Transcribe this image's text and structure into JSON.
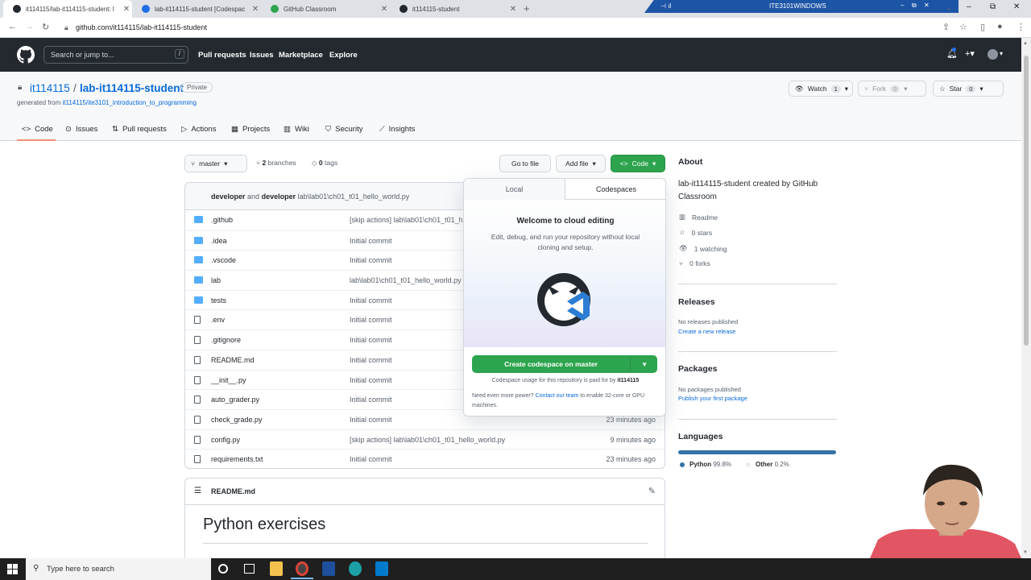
{
  "browser": {
    "tabs": [
      {
        "title": "it114115/lab-it114115-student: l",
        "active": true
      },
      {
        "title": "lab-it114115-student [Codespac",
        "active": false
      },
      {
        "title": "GitHub Classroom",
        "active": false
      },
      {
        "title": "it114115-student",
        "active": false
      }
    ],
    "remote_title": "ITE3101WINDOWS",
    "url": "github.com/it114115/lab-it114115-student"
  },
  "gh_header": {
    "search_placeholder": "Search or jump to...",
    "search_key": "/",
    "nav": [
      "Pull requests",
      "Issues",
      "Marketplace",
      "Explore"
    ]
  },
  "repo": {
    "owner": "it114115",
    "sep": "/",
    "name": "lab-it114115-student",
    "visibility": "Private",
    "generated_prefix": "generated from",
    "generated_link": "it114115/ite3101_introduction_to_programming",
    "watch_label": "Watch",
    "watch_count": "1",
    "fork_label": "Fork",
    "fork_count": "0",
    "star_label": "Star",
    "star_count": "0",
    "tabs": [
      "Code",
      "Issues",
      "Pull requests",
      "Actions",
      "Projects",
      "Wiki",
      "Security",
      "Insights"
    ]
  },
  "toolbar": {
    "branch": "master",
    "branches": "2",
    "branches_label": "branches",
    "tags": "0",
    "tags_label": "tags",
    "go_to_file": "Go to file",
    "add_file": "Add file",
    "code": "Code"
  },
  "commit": {
    "author1": "developer",
    "and": "and",
    "author2": "developer",
    "message": "lab\\lab01\\ch01_t01_hello_world.py"
  },
  "files": [
    {
      "name": ".github",
      "type": "dir",
      "msg": "[skip actions] lab\\lab01\\ch01_t01_h",
      "time": ""
    },
    {
      "name": ".idea",
      "type": "dir",
      "msg": "Initial commit",
      "time": ""
    },
    {
      "name": ".vscode",
      "type": "dir",
      "msg": "Initial commit",
      "time": ""
    },
    {
      "name": "lab",
      "type": "dir",
      "msg": "lab\\lab01\\ch01_t01_hello_world.py",
      "time": ""
    },
    {
      "name": "tests",
      "type": "dir",
      "msg": "Initial commit",
      "time": ""
    },
    {
      "name": ".env",
      "type": "file",
      "msg": "Initial commit",
      "time": ""
    },
    {
      "name": ".gitignore",
      "type": "file",
      "msg": "Initial commit",
      "time": ""
    },
    {
      "name": "README.md",
      "type": "file",
      "msg": "Initial commit",
      "time": ""
    },
    {
      "name": "__init__.py",
      "type": "file",
      "msg": "Initial commit",
      "time": ""
    },
    {
      "name": "auto_grader.py",
      "type": "file",
      "msg": "Initial commit",
      "time": ""
    },
    {
      "name": "check_grade.py",
      "type": "file",
      "msg": "Initial commit",
      "time": "23 minutes ago"
    },
    {
      "name": "config.py",
      "type": "file",
      "msg": "[skip actions] lab\\lab01\\ch01_t01_hello_world.py",
      "time": "9 minutes ago"
    },
    {
      "name": "requirements.txt",
      "type": "file",
      "msg": "Initial commit",
      "time": "23 minutes ago"
    }
  ],
  "readme": {
    "filename": "README.md",
    "heading": "Python exercises"
  },
  "code_dropdown": {
    "tab_local": "Local",
    "tab_codespaces": "Codespaces",
    "title": "Welcome to cloud editing",
    "desc": "Edit, debug, and run your repository without local cloning and setup.",
    "create_button": "Create codespace on master",
    "usage_text": "Codespace usage for this repository is paid for by",
    "usage_owner": "it114115",
    "power_text1": "Need even more power?",
    "power_link": "Contact our team",
    "power_text2": "to enable 32-core or GPU machines."
  },
  "about": {
    "title": "About",
    "description": "lab-it114115-student created by GitHub Classroom",
    "readme": "Readme",
    "stars": "0 stars",
    "watching": "1 watching",
    "forks": "0 forks"
  },
  "releases": {
    "title": "Releases",
    "none": "No releases published",
    "link": "Create a new release"
  },
  "packages": {
    "title": "Packages",
    "none": "No packages published",
    "link": "Publish your first package"
  },
  "languages": {
    "title": "Languages",
    "items": [
      {
        "name": "Python",
        "pct": "99.8%",
        "color": "#3572A5",
        "share": 99.8
      },
      {
        "name": "Other",
        "pct": "0.2%",
        "color": "#ededed",
        "share": 0.2
      }
    ]
  },
  "taskbar": {
    "search_placeholder": "Type here to search"
  }
}
